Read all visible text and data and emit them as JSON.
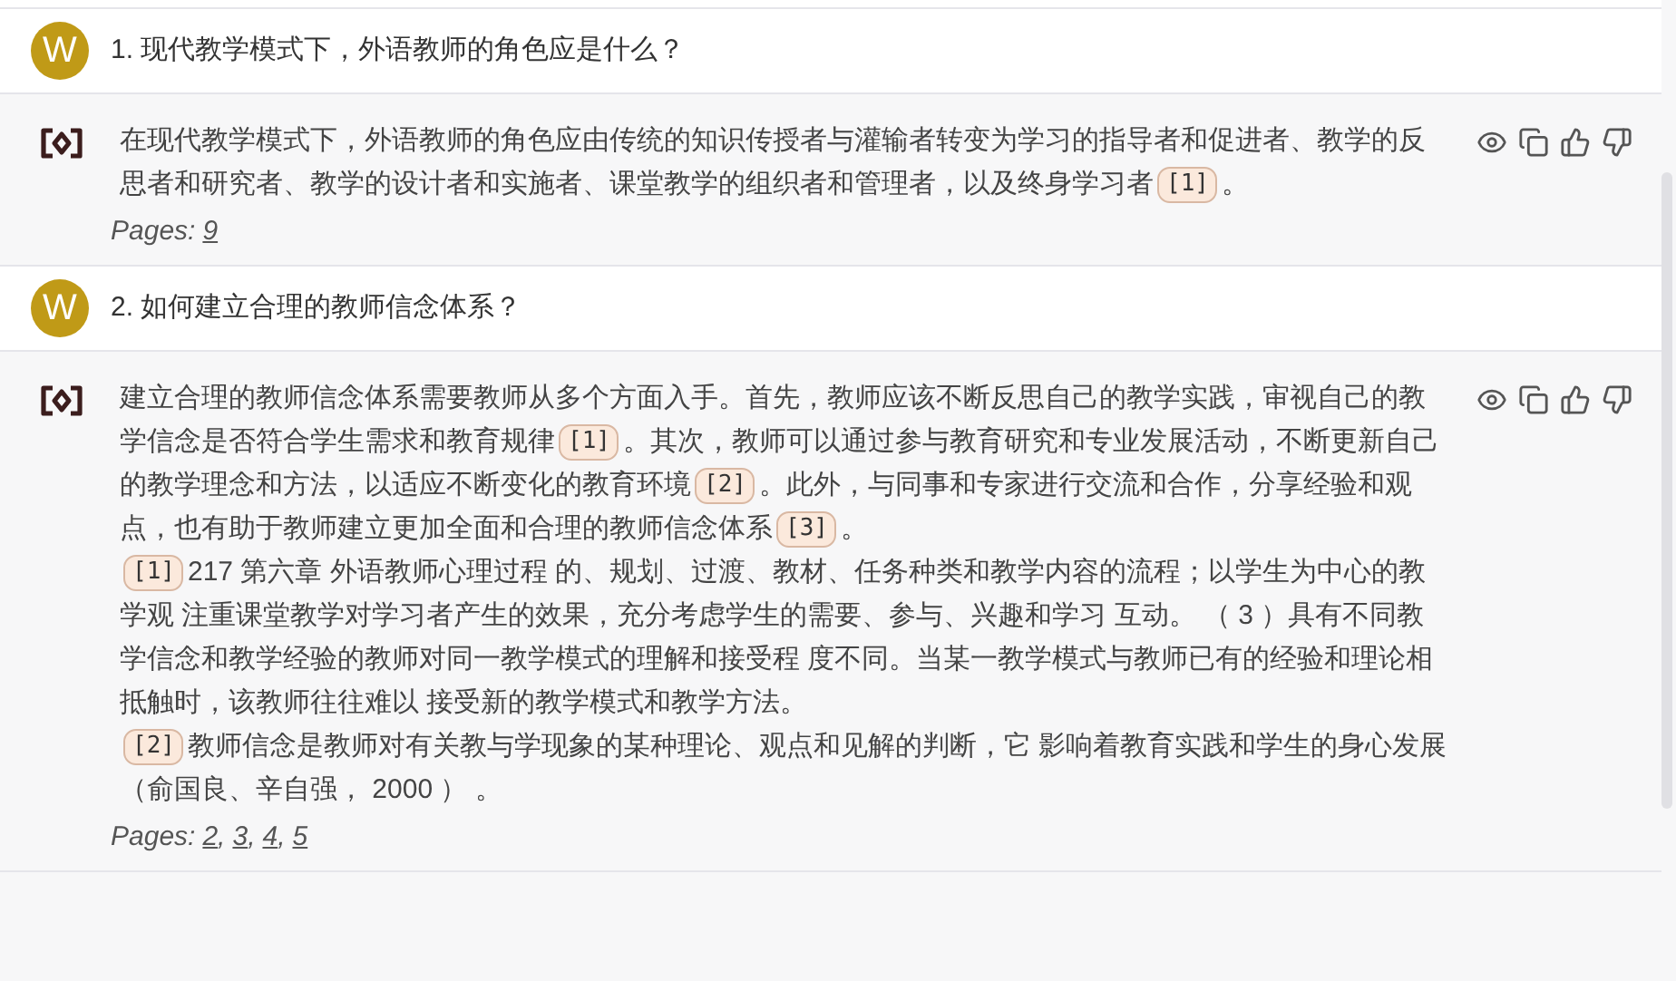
{
  "items": [
    {
      "question": {
        "avatar": "W",
        "text": "1. 现代教学模式下，外语教师的角色应是什么？"
      },
      "answer": {
        "paragraphs": [
          [
            {
              "kind": "text",
              "text": "在现代教学模式下，外语教师的角色应由传统的知识传授者与灌输者转变为学习的指导者和促进者、教学的反思者和研究者、教学的设计者和实施者、课堂教学的组织者和管理者，以及终身学习者"
            },
            {
              "kind": "cite",
              "text": "[1]"
            },
            {
              "kind": "text",
              "text": "。"
            }
          ]
        ],
        "pages_label": "Pages:",
        "pages": [
          "9"
        ]
      }
    },
    {
      "question": {
        "avatar": "W",
        "text": "2. 如何建立合理的教师信念体系？"
      },
      "answer": {
        "paragraphs": [
          [
            {
              "kind": "text",
              "text": "建立合理的教师信念体系需要教师从多个方面入手。首先，教师应该不断反思自己的教学实践，审视自己的教学信念是否符合学生需求和教育规律"
            },
            {
              "kind": "cite",
              "text": "[1]"
            },
            {
              "kind": "text",
              "text": "。其次，教师可以通过参与教育研究和专业发展活动，不断更新自己的教学理念和方法，以适应不断变化的教育环境"
            },
            {
              "kind": "cite",
              "text": "[2]"
            },
            {
              "kind": "text",
              "text": "。此外，与同事和专家进行交流和合作，分享经验和观点，也有助于教师建立更加全面和合理的教师信念体系"
            },
            {
              "kind": "cite",
              "text": "[3]"
            },
            {
              "kind": "text",
              "text": "。"
            }
          ],
          [
            {
              "kind": "cite",
              "text": "[1]"
            },
            {
              "kind": "text",
              "text": "217 第六章 外语教师心理过程 的、规划、过渡、教材、任务种类和教学内容的流程；以学生为中心的教学观 注重课堂教学对学习者产生的效果，充分考虑学生的需要、参与、兴趣和学习 互动。 （ 3 ）具有不同教学信念和教学经验的教师对同一教学模式的理解和接受程 度不同。当某一教学模式与教师已有的经验和理论相抵触时，该教师往往难以 接受新的教学模式和教学方法。"
            }
          ],
          [
            {
              "kind": "cite",
              "text": "[2]"
            },
            {
              "kind": "text",
              "text": "教师信念是教师对有关教与学现象的某种理论、观点和见解的判断，它 影响着教育实践和学生的身心发展（俞国良、辛自强， 2000 ） 。"
            }
          ]
        ],
        "pages_label": "Pages:",
        "pages_separator": ",",
        "pages": [
          "2",
          "3",
          "4",
          "5"
        ]
      }
    }
  ]
}
